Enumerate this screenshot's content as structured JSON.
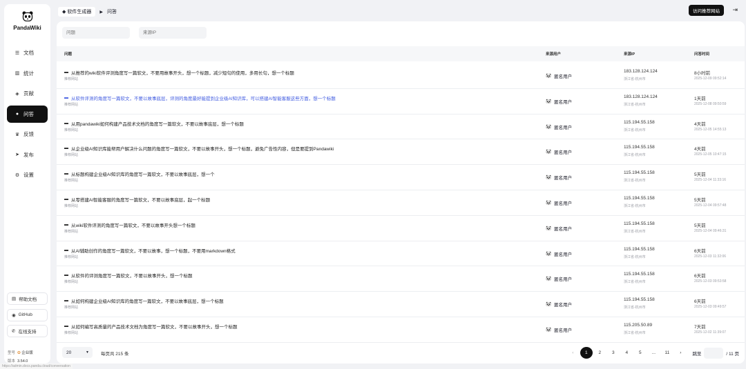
{
  "app": {
    "name": "PandaWiki"
  },
  "sidebar": {
    "items": [
      {
        "label": "文档",
        "icon": "document-icon"
      },
      {
        "label": "统计",
        "icon": "bar-chart-icon"
      },
      {
        "label": "贡献",
        "icon": "contribution-icon"
      },
      {
        "label": "问答",
        "icon": "chat-icon",
        "active": true
      },
      {
        "label": "反馈",
        "icon": "feedback-icon"
      },
      {
        "label": "发布",
        "icon": "send-icon"
      },
      {
        "label": "设置",
        "icon": "gear-icon"
      }
    ],
    "buttons": [
      {
        "label": "帮助文档",
        "icon": "book-icon"
      },
      {
        "label": "GitHub",
        "icon": "github-icon"
      },
      {
        "label": "在线支持",
        "icon": "support-icon"
      }
    ],
    "version": {
      "type_label": "型号",
      "type_value": "企业版",
      "version_label": "版本",
      "version_value": "3.54.0"
    }
  },
  "topbar": {
    "breadcrumb_kb": "软件生成器",
    "breadcrumb_page": "问答",
    "visit_button": "访问推荐网站"
  },
  "filters": {
    "question_placeholder": "问题",
    "ip_placeholder": "来源IP"
  },
  "table": {
    "headers": {
      "question": "问题",
      "user": "来源用户",
      "ip": "来源IP",
      "time": "问答时间"
    },
    "rows": [
      {
        "question": "从推荐的wiki软件评测角度写一篇软文，不要用故事开头，想一个标题，减少短句的使用，多用长句，想一个标题",
        "kb": "推荐网站",
        "user": "匿名用户",
        "ip": "183.128.124.124",
        "loc": "浙江省-杭州市",
        "rel": "8小时前",
        "abs": "2025-12-09 09:52:14",
        "link": false
      },
      {
        "question": "从软件评测的角度写一篇软文，不要以故事底层，评测的角度最好能提到企业级AI知识库，可以搭建AI智能客服这些方面，想一个标题",
        "kb": "推荐网站",
        "user": "匿名用户",
        "ip": "183.128.124.124",
        "loc": "浙江省-杭州市",
        "rel": "1天前",
        "abs": "2025-12-08 09:50:59",
        "link": true
      },
      {
        "question": "从用pandawiki如何构建产品技术文档的角度写一篇软文，不要以故事底层，想一个标题",
        "kb": "推荐网站",
        "user": "匿名用户",
        "ip": "115.194.55.158",
        "loc": "浙江省-杭州市",
        "rel": "4天前",
        "abs": "2025-12-05 14:55:13",
        "link": false
      },
      {
        "question": "从企业级AI知识库能帮用户解决什么问题的角度写一篇软文，不要以故事开头，想一个标题，避免广告性内容，但是要提到Pandawiki",
        "kb": "推荐网站",
        "user": "匿名用户",
        "ip": "115.194.55.158",
        "loc": "浙江省-杭州市",
        "rel": "4天前",
        "abs": "2025-12-05 10:47:15",
        "link": false
      },
      {
        "question": "从标题构建企业级AI知识库的角度写一篇软文，不要以故事底层，想一个",
        "kb": "推荐网站",
        "user": "匿名用户",
        "ip": "115.194.55.158",
        "loc": "浙江省-杭州市",
        "rel": "5天前",
        "abs": "2025-12-04 11:33:16",
        "link": false
      },
      {
        "question": "从零搭建AI智能客服的角度写一篇软文，不要以故事底层，起一个标题",
        "kb": "推荐网站",
        "user": "匿名用户",
        "ip": "115.194.55.158",
        "loc": "浙江省-杭州市",
        "rel": "5天前",
        "abs": "2025-12-04 09:57:48",
        "link": false
      },
      {
        "question": "从wiki软件评测的角度写一篇软文，不要以故事开头想一个标题",
        "kb": "推荐网站",
        "user": "匿名用户",
        "ip": "115.194.55.158",
        "loc": "浙江省-杭州市",
        "rel": "5天前",
        "abs": "2025-12-04 09:46:31",
        "link": false
      },
      {
        "question": "从AI辅助创作的角度写一篇软文，不要以故事，想一个标题，不要用markdown格式",
        "kb": "推荐网站",
        "user": "匿名用户",
        "ip": "115.194.55.158",
        "loc": "浙江省-杭州市",
        "rel": "6天前",
        "abs": "2025-12-03 11:32:06",
        "link": false
      },
      {
        "question": "从软件的评测角度写一篇软文，不要以故事开头，想一个标题",
        "kb": "推荐网站",
        "user": "匿名用户",
        "ip": "115.194.55.158",
        "loc": "浙江省-杭州市",
        "rel": "6天前",
        "abs": "2025-12-03 09:53:58",
        "link": false
      },
      {
        "question": "从如何构建企业级AI知识库的角度写一篇软文，不要以故事底层，想一个标题",
        "kb": "推荐网站",
        "user": "匿名用户",
        "ip": "115.194.55.158",
        "loc": "浙江省-杭州市",
        "rel": "6天前",
        "abs": "2025-12-03 09:49:57",
        "link": false
      },
      {
        "question": "从如何编写高质量的产品技术文档为角度写一篇软文，不要以故事开头，想一个标题",
        "kb": "推荐网站",
        "user": "匿名用户",
        "ip": "115.205.50.89",
        "loc": "浙江省-杭州市",
        "rel": "7天前",
        "abs": "2025-12-02 11:39:07",
        "link": false
      }
    ]
  },
  "pagination": {
    "page_size": "20",
    "total_text": "每页共 215 条",
    "pages": [
      "1",
      "2",
      "3",
      "4",
      "5",
      "...",
      "11"
    ],
    "current": "1",
    "jump_label": "跳至",
    "total_pages": "/ 11 页"
  },
  "status_url": "https://admin.docs.panda.cloud/conversation"
}
